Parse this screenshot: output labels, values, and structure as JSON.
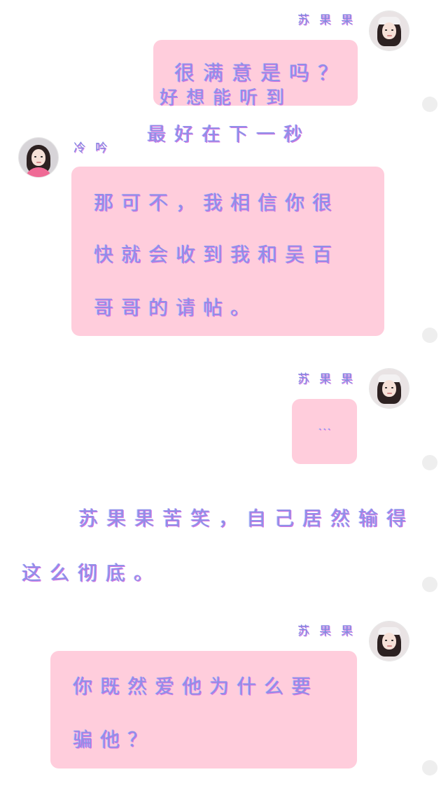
{
  "chat": {
    "names": {
      "right": "苏果果",
      "left": "冷吟"
    },
    "messages": [
      {
        "sender": "苏果果",
        "text": "很满意是吗？"
      },
      {
        "sender": "冷吟",
        "lines": [
          "那可不，我相信你很",
          "快就会收到我和吴百",
          "哥哥的请帖。"
        ]
      },
      {
        "sender": "苏果果",
        "text": "..."
      },
      {
        "sender": "苏果果",
        "lines": [
          "你既然爱他为什么要",
          "骗他？"
        ]
      }
    ]
  },
  "narration": [
    "好想能听到",
    "最好在下一秒",
    "苏果果苦笑，自己居然输得",
    "这么彻底。"
  ],
  "colors": {
    "bubble": "#ffcddc",
    "text": "#8f8fe8",
    "shadow": "#d873e0"
  },
  "icons": [
    "avatar-su-guoguo",
    "avatar-leng-yin",
    "status-dot"
  ]
}
